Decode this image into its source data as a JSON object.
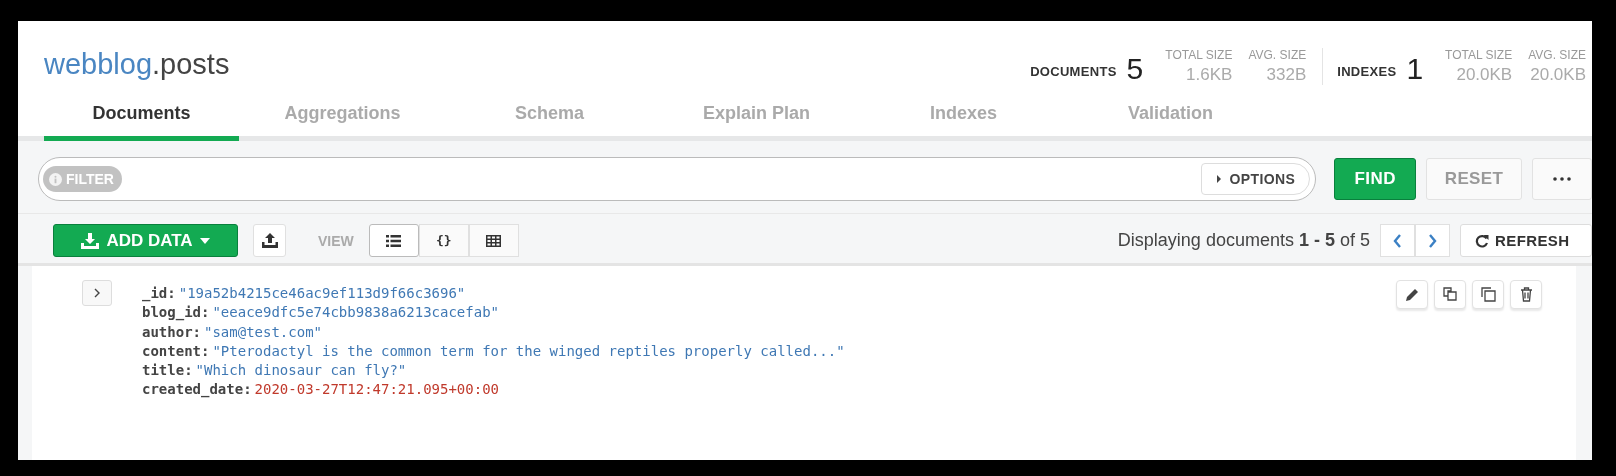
{
  "namespace": {
    "database": "webblog",
    "separator": ".",
    "collection": "posts"
  },
  "stats": [
    {
      "label": "DOCUMENTS",
      "count": "5",
      "sizes": [
        {
          "label": "TOTAL SIZE",
          "value": "1.6KB"
        },
        {
          "label": "AVG. SIZE",
          "value": "332B"
        }
      ]
    },
    {
      "label": "INDEXES",
      "count": "1",
      "sizes": [
        {
          "label": "TOTAL SIZE",
          "value": "20.0KB"
        },
        {
          "label": "AVG. SIZE",
          "value": "20.0KB"
        }
      ]
    }
  ],
  "tabs": [
    {
      "label": "Documents",
      "selected": true
    },
    {
      "label": "Aggregations",
      "selected": false
    },
    {
      "label": "Schema",
      "selected": false
    },
    {
      "label": "Explain Plan",
      "selected": false
    },
    {
      "label": "Indexes",
      "selected": false
    },
    {
      "label": "Validation",
      "selected": false
    }
  ],
  "query_bar": {
    "filter_label": "FILTER",
    "options_label": "OPTIONS",
    "buttons": [
      {
        "label": "FIND",
        "kind": "primary"
      },
      {
        "label": "RESET",
        "kind": "default"
      }
    ]
  },
  "toolbar": {
    "add_data": "ADD DATA",
    "view_label": "VIEW",
    "views": [
      {
        "kind": "list",
        "selected": true
      },
      {
        "kind": "json",
        "label": "{}",
        "selected": false
      },
      {
        "kind": "table",
        "selected": false
      }
    ],
    "paging": "Displaying documents **1 - 5** of 5",
    "refresh": "REFRESH"
  },
  "document": {
    "fields": [
      {
        "key": "_id:",
        "value": "\"19a52b4215ce46ac9ef113d9f66c3696\"",
        "kind": "string"
      },
      {
        "key": "blog_id:",
        "value": "\"eeace9dfc5e74cbb9838a6213cacefab\"",
        "kind": "string"
      },
      {
        "key": "author:",
        "value": "\"sam@test.com\"",
        "kind": "string"
      },
      {
        "key": "content:",
        "value": "\"Pterodactyl is the common term for the winged reptiles properly called...\"",
        "kind": "string"
      },
      {
        "key": "title:",
        "value": "\"Which dinosaur can fly?\"",
        "kind": "string"
      },
      {
        "key": "created_date:",
        "value": "2020-03-27T12:47:21.095+00:00",
        "kind": "date"
      }
    ]
  }
}
